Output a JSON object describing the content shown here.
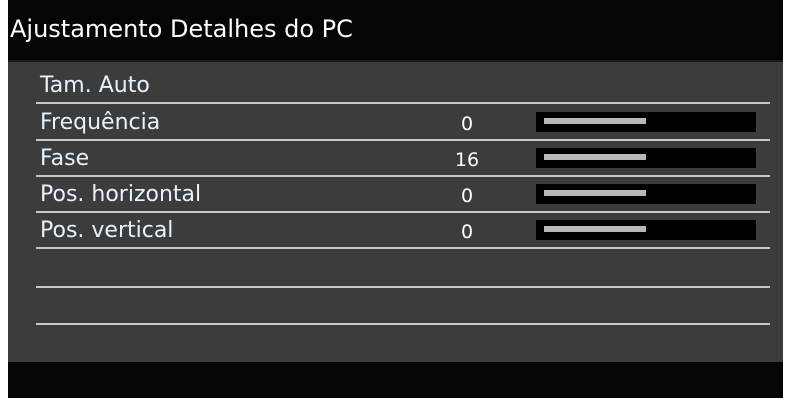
{
  "window": {
    "title": "Ajustamento Detalhes do PC"
  },
  "menu": {
    "items": [
      {
        "label": "Tam. Auto",
        "value": null,
        "level": null
      },
      {
        "label": "Frequência",
        "value": "0",
        "level": 0.5
      },
      {
        "label": "Fase",
        "value": "16",
        "level": 0.5
      },
      {
        "label": "Pos. horizontal",
        "value": "0",
        "level": 0.5
      },
      {
        "label": "Pos. vertical",
        "value": "0",
        "level": 0.5
      }
    ]
  },
  "colors": {
    "panel_background": "#3c3c3c",
    "title_background": "#050505",
    "title_text": "#ffffff",
    "item_text": "#e6f2ff",
    "divider": "#c8c8c8",
    "slider_track": "#000000",
    "slider_fill": "#b8b8b8"
  }
}
